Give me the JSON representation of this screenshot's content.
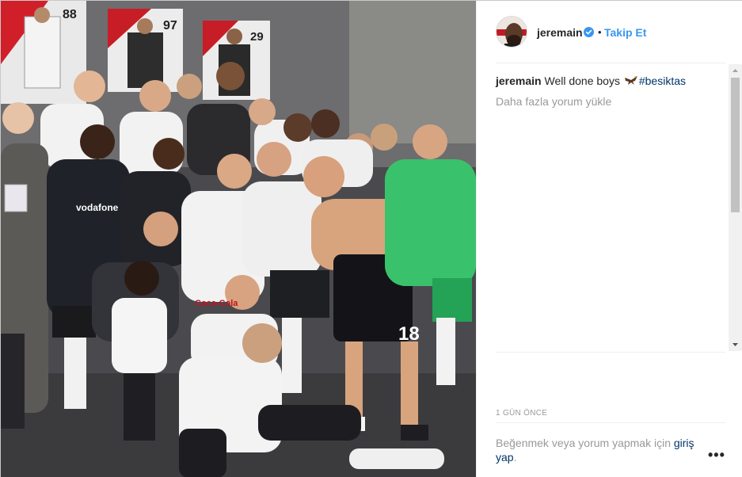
{
  "post": {
    "photo": {
      "jersey_numbers": [
        "88",
        "97",
        "29",
        "18"
      ],
      "sponsor_text": "vodafone",
      "shirt_text": "Coca-Cola"
    },
    "author": {
      "username": "jeremain",
      "verified_icon": "verified-badge-icon",
      "separator": "•",
      "follow_label": "Takip Et",
      "follow_color": "#3897f0"
    },
    "caption": {
      "username": "jeremain",
      "text": "Well done boys",
      "emoji_icon": "eagle-emoji-icon",
      "hashtag": "#besiktas"
    },
    "load_more_label": "Daha fazla yorum yükle",
    "timestamp": "1 GÜN ÖNCE",
    "login_prompt": {
      "text": "Beğenmek veya yorum yapmak için ",
      "link_label": "giriş yap",
      "suffix": "."
    },
    "more_options_label": "•••",
    "colors": {
      "text": "#262626",
      "muted": "#999999",
      "link": "#003569",
      "accent": "#3897f0"
    }
  }
}
